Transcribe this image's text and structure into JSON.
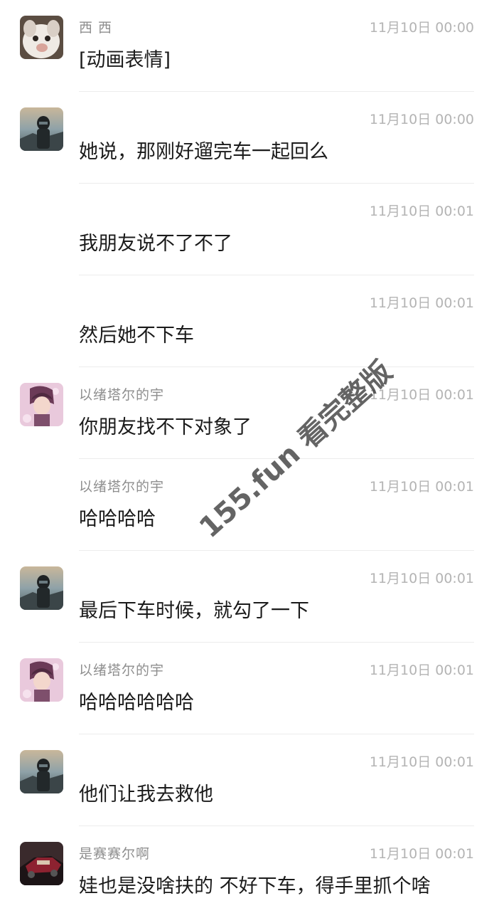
{
  "messages": [
    {
      "avatar": "cat-avatar-icon",
      "sender": "西 西",
      "time": "11月10日 00:00",
      "text": "[动画表情]"
    },
    {
      "avatar": "helmet-avatar-icon",
      "sender": "",
      "time": "11月10日 00:00",
      "text": "她说，那刚好遛完车一起回么"
    },
    {
      "avatar": "",
      "sender": "",
      "time": "11月10日 00:01",
      "text": "我朋友说不了不了"
    },
    {
      "avatar": "",
      "sender": "",
      "time": "11月10日 00:01",
      "text": "然后她不下车"
    },
    {
      "avatar": "anime-avatar-icon",
      "sender": "以绪塔尔的宇",
      "time": "11月10日 00:01",
      "text": "你朋友找不下对象了"
    },
    {
      "avatar": "",
      "sender": "以绪塔尔的宇",
      "time": "11月10日 00:01",
      "text": "哈哈哈哈"
    },
    {
      "avatar": "helmet-avatar-icon",
      "sender": "",
      "time": "11月10日 00:01",
      "text": "最后下车时候，就勾了一下"
    },
    {
      "avatar": "anime-avatar-icon",
      "sender": "以绪塔尔的宇",
      "time": "11月10日 00:01",
      "text": "哈哈哈哈哈哈"
    },
    {
      "avatar": "helmet-avatar-icon",
      "sender": "",
      "time": "11月10日 00:01",
      "text": "他们让我去救他"
    },
    {
      "avatar": "car-avatar-icon",
      "sender": "是赛赛尔啊",
      "time": "11月10日 00:01",
      "text": "娃也是没啥扶的 不好下车，得手里抓个啥"
    }
  ],
  "watermark": "155.fun 看完整版"
}
